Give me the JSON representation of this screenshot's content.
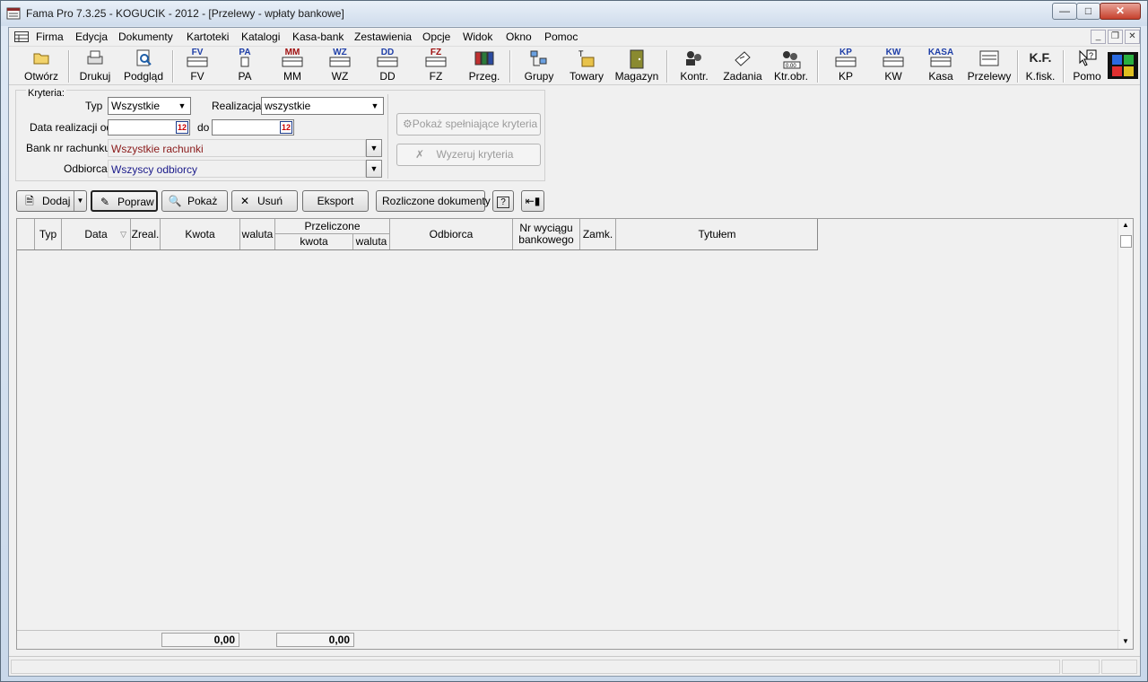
{
  "window": {
    "title": "Fama Pro 7.3.25 - KOGUCIK - 2012 - [Przelewy - wpłaty bankowe]"
  },
  "menu": [
    "Firma",
    "Edycja",
    "Dokumenty",
    "Kartoteki",
    "Katalogi",
    "Kasa-bank",
    "Zestawienia",
    "Opcje",
    "Widok",
    "Okno",
    "Pomoc"
  ],
  "toolbar": {
    "items": [
      {
        "label": "Otwórz"
      },
      {
        "label": "Drukuj"
      },
      {
        "label": "Podgląd"
      },
      {
        "label": "FV",
        "code": "FV"
      },
      {
        "label": "PA",
        "code": "PA"
      },
      {
        "label": "MM",
        "code": "MM"
      },
      {
        "label": "WZ",
        "code": "WZ"
      },
      {
        "label": "DD",
        "code": "DD"
      },
      {
        "label": "FZ",
        "code": "FZ"
      },
      {
        "label": "Przeg."
      },
      {
        "label": "Grupy"
      },
      {
        "label": "Towary"
      },
      {
        "label": "Magazyn"
      },
      {
        "label": "Kontr."
      },
      {
        "label": "Zadania"
      },
      {
        "label": "Ktr.obr."
      },
      {
        "label": "KP",
        "code": "KP"
      },
      {
        "label": "KW",
        "code": "KW"
      },
      {
        "label": "Kasa",
        "code": "KASA"
      },
      {
        "label": "Przelewy"
      },
      {
        "label": "K.fisk.",
        "code": "K.F."
      },
      {
        "label": "Pomo"
      }
    ],
    "ktrobr_readout": "0.00"
  },
  "criteria": {
    "legend": "Kryteria:",
    "typ_label": "Typ",
    "typ_value": "Wszystkie",
    "realizacja_label": "Realizacja",
    "realizacja_value": "wszystkie",
    "data_od_label": "Data realizacji od",
    "do_label": "do",
    "calendar_glyph": "12",
    "bank_label": "Bank nr rachunku",
    "bank_value": "Wszystkie rachunki",
    "odbiorca_label": "Odbiorca",
    "odbiorca_value": "Wszyscy odbiorcy",
    "pokaz_btn": "Pokaż spełniające kryteria",
    "wyzeruj_btn": "Wyzeruj kryteria"
  },
  "actions": {
    "dodaj": "Dodaj",
    "popraw": "Popraw",
    "pokaz": "Pokaż",
    "usun": "Usuń",
    "eksport": "Eksport",
    "rozliczone": "Rozliczone dokumenty",
    "help_glyph": "?"
  },
  "grid": {
    "columns": {
      "typ": "Typ",
      "data": "Data",
      "zreal": "Zreal.",
      "kwota": "Kwota",
      "waluta": "waluta",
      "przeliczone": "Przeliczone",
      "p_kwota": "kwota",
      "p_waluta": "waluta",
      "odbiorca": "Odbiorca",
      "nr_wyciagu_1": "Nr wyciągu",
      "nr_wyciagu_2": "bankowego",
      "zamk": "Zamk.",
      "tytulem": "Tytułem"
    },
    "sum_kwota": "0,00",
    "sum_przeliczone": "0,00"
  }
}
